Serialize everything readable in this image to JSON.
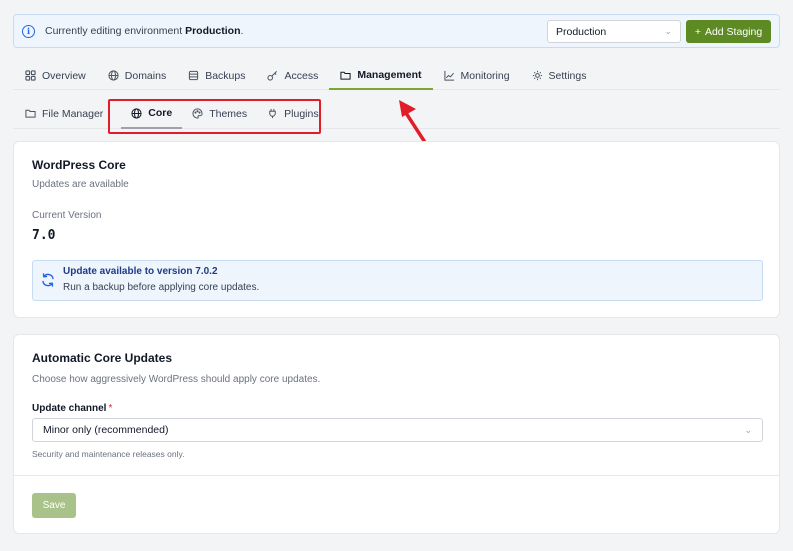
{
  "banner": {
    "prefix": "Currently editing environment ",
    "environment": "Production",
    "suffix": ".",
    "selected_env": "Production",
    "add_staging_label": "Add Staging"
  },
  "tabs": [
    {
      "label": "Overview",
      "icon": "grid-icon"
    },
    {
      "label": "Domains",
      "icon": "globe-icon"
    },
    {
      "label": "Backups",
      "icon": "database-icon"
    },
    {
      "label": "Access",
      "icon": "key-icon"
    },
    {
      "label": "Management",
      "icon": "folder-icon",
      "active": true
    },
    {
      "label": "Monitoring",
      "icon": "chart-icon"
    },
    {
      "label": "Settings",
      "icon": "gear-icon"
    }
  ],
  "subtabs": [
    {
      "label": "File Manager",
      "icon": "folder-icon"
    },
    {
      "label": "Core",
      "icon": "globe-icon",
      "active": true
    },
    {
      "label": "Themes",
      "icon": "palette-icon"
    },
    {
      "label": "Plugins",
      "icon": "plug-icon"
    }
  ],
  "core_card": {
    "title": "WordPress Core",
    "subtitle": "Updates are available",
    "version_label": "Current Version",
    "version_value": "7.0",
    "update_title": "Update available to version 7.0.2",
    "update_desc": "Run a backup before applying core updates."
  },
  "auto_card": {
    "title": "Automatic Core Updates",
    "subtitle": "Choose how aggressively WordPress should apply core updates.",
    "field_label": "Update channel",
    "required_mark": "*",
    "channel_value": "Minor only (recommended)",
    "help_text": "Security and maintenance releases only.",
    "save_label": "Save"
  },
  "colors": {
    "accent": "#5d8a22",
    "info_bg": "#eef5fd",
    "highlight": "#e11d2a"
  }
}
